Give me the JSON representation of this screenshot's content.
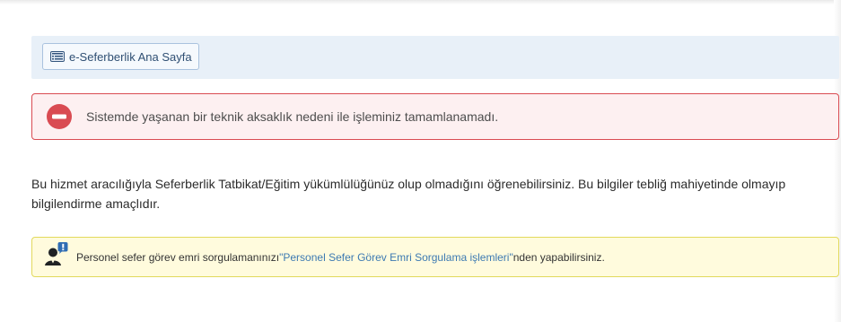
{
  "top_panel": {
    "home_button_label": "e-Seferberlik Ana Sayfa"
  },
  "alert": {
    "error_message": "Sistemde yaşanan bir teknik aksaklık nedeni ile işleminiz tamamlanamadı."
  },
  "content": {
    "info_paragraph": "Bu hizmet aracılığıyla Seferberlik Tatbikat/Eğitim yükümlülüğünüz olup olmadığını öğrenebilirsiniz. Bu bilgiler tebliğ mahiyetinde olmayıp bilgilendirme amaçlıdır."
  },
  "notice": {
    "text_before": "Personel sefer görev emri sorgulamanınızı",
    "link_text": "\"Personel Sefer Görev Emri Sorgulama işlemleri\"",
    "text_after": "nden yapabilirsiniz."
  },
  "icons": {
    "home_button_icon": "list-alt-icon",
    "error_icon": "minus-circle-icon",
    "notice_icon": "person-exclamation-icon"
  },
  "colors": {
    "top_panel_background": "#e8f0f8",
    "error_red": "#d94b52",
    "error_background": "#fdf0f1",
    "notice_background": "#fffbdd",
    "notice_border": "#e2d95c",
    "link_blue": "#3d7ab2"
  }
}
